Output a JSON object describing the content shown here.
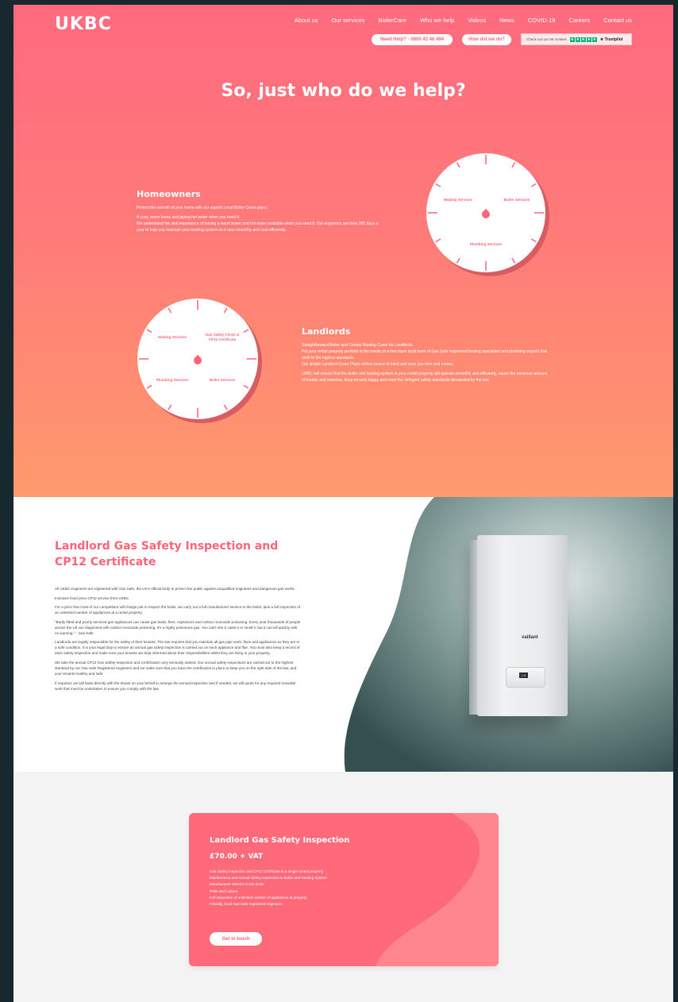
{
  "header": {
    "logo": "UKBC",
    "nav": [
      "About us",
      "Our services",
      "BoilerCare",
      "Who we help",
      "Videos",
      "News",
      "COVID-19",
      "Careers",
      "Contact us"
    ],
    "need_help": "Need Help? - 0800 43 46 494",
    "how_did_we_do": "How did we do?",
    "trustpilot": {
      "text": "Check out our 86 reviews",
      "brand": "★ Trustpilot",
      "stars": 5
    }
  },
  "hero": {
    "title": "So, just who do we help?"
  },
  "homeowners": {
    "title": "Homeowners",
    "p1": "Protect the warmth of your home with our superb Local Boiler Cover plans.",
    "p2": "A cosy, warm home and piping hot water when you need it.",
    "p3": "We understand the vital importance of having a warm home and hot water available when you need it. Our engineers are here 365 days a year to help you maintain your heating system so it runs smoothly and cost efficiently.",
    "dial": {
      "a": "Heating Services",
      "b": "Boiler Services",
      "c": "Plumbing Services"
    }
  },
  "landlords": {
    "title": "Landlords",
    "p1": "Straightforward Boiler and Central Heating Cover for Landlords.",
    "p2": "Put your rental property portfolio in the hands of a first-class local team of Gas Safe registered heating specialists and plumbing experts that work to the highest standards.",
    "p3": "Our simple Landlord Cover Plans deliver peace of mind and save you time and money.",
    "p4": "UKBC will ensure that the boiler and heating system in your rental property will operate smoothly and efficiently, cause the minimum amount of trouble and expense, keep tenants happy and meet the stringent safety standards demanded by the law.",
    "dial": {
      "a": "Heating Services",
      "b": "Gas Safety Check & CP12 Certificate",
      "c": "Plumbing Services",
      "d": "Boiler Services"
    }
  },
  "inspection": {
    "title": "Landlord Gas Safety Inspection and CP12 Certificate",
    "paragraphs": [
      "All UKBC engineers are registered with Gas Safe, the UK's official body to protect the public against unqualified engineers and dangerous gas works.",
      "Inclusive fixed price CP12 service from UKBC",
      "For a price that most of our competitors will charge just to inspect the boiler, we carry out a full manufacturer service to the boiler, plus a full inspection of an unlimited number of appliances at a rental property.",
      "\"Badly fitted and poorly serviced gas appliances can cause gas leaks, fires, explosions and carbon monoxide poisoning. Every year thousands of people across the UK are diagnosed with carbon monoxide poisoning. It's a highly poisonous gas. You can't see it, taste it or smell it, but it can kill quickly with no warning.\" - Gas Safe",
      "Landlords are legally responsible for the safety of their tenants. The law requires that you maintain all gas pipe work, flues and appliances so they are in a safe condition. It is your legal duty to ensure an annual gas safety inspection is carried out on each appliance and flue. You must also keep a record of each safety inspection and make sure your tenants are kept informed about their responsibilities whilst they are living in your property.",
      "We take the annual CP12 Gas Safety Inspection and Certification very seriously indeed. Our annual safety inspections are carried out to the highest standard by our Gas Safe Registered engineers and we make sure that you have the certification in place to keep you on the right side of the law, and your tenants healthy and safe.",
      "If required, we will liaise directly with the tenant on your behalf to arrange the annual inspection and if needed, we will quote for any required remedial work that must be undertaken to ensure you comply with the law."
    ],
    "boiler_brand": "vaillant",
    "boiler_display": "1.5"
  },
  "price_card": {
    "title": "Landlord Gas Safety Inspection",
    "price": "£70.00 + VAT",
    "items": [
      "Gas Safety Inspection and CP12 Certificate to a single rented property",
      "Maintenance and Annual Safety Inspection to Boiler and Heating System",
      "Manufacturer Service to the boiler",
      "Parts and Labour",
      "Full inspection of unlimited number of appliances at property",
      "Friendly, local Gas Safe registered engineers"
    ],
    "button": "Get in touch"
  },
  "colors": {
    "brand_pink": "#ff6478",
    "hero_top": "#ff6a7f",
    "hero_bottom": "#ff9a6c",
    "teal_blob": "#3f5a58",
    "trustpilot_green": "#00b67a"
  }
}
